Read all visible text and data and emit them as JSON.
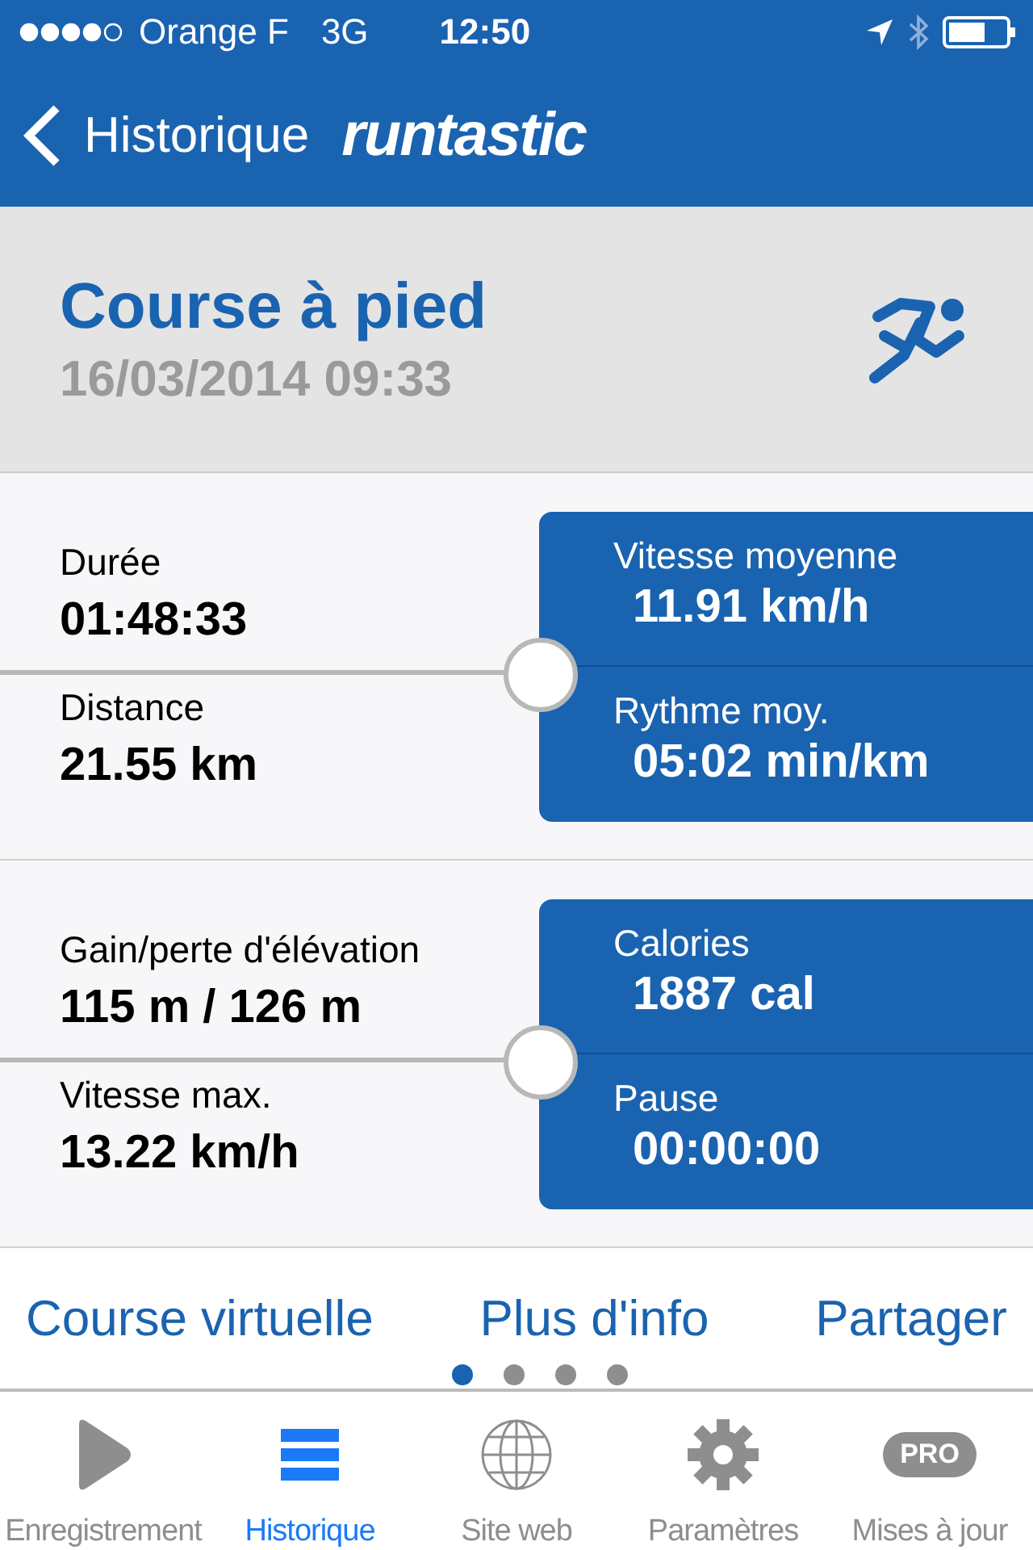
{
  "status_bar": {
    "carrier": "Orange F",
    "network": "3G",
    "time": "12:50"
  },
  "nav": {
    "back_label": "Historique",
    "logo": "runtastic"
  },
  "activity": {
    "title": "Course à pied",
    "date": "16/03/2014 09:33"
  },
  "stat_groups": [
    {
      "left": [
        {
          "label": "Durée",
          "value": "01:48:33"
        },
        {
          "label": "Distance",
          "value": "21.55 km"
        }
      ],
      "right": [
        {
          "label": "Vitesse moyenne",
          "value": "11.91 km/h"
        },
        {
          "label": "Rythme moy.",
          "value": "05:02 min/km"
        }
      ]
    },
    {
      "left": [
        {
          "label": "Gain/perte d'élévation",
          "value": "115 m / 126 m"
        },
        {
          "label": "Vitesse max.",
          "value": "13.22 km/h"
        }
      ],
      "right": [
        {
          "label": "Calories",
          "value": "1887 cal"
        },
        {
          "label": "Pause",
          "value": "00:00:00"
        }
      ]
    }
  ],
  "actions": [
    "Course virtuelle",
    "Plus d'info",
    "Partager"
  ],
  "page_dots": [
    {
      "selected": true
    },
    {
      "selected": false
    },
    {
      "selected": false
    },
    {
      "selected": false
    }
  ],
  "tabs": [
    {
      "kind": "record",
      "label": "Enregistrement",
      "selected": false
    },
    {
      "kind": "history",
      "label": "Historique",
      "selected": true
    },
    {
      "kind": "web",
      "label": "Site web",
      "selected": false
    },
    {
      "kind": "settings",
      "label": "Paramètres",
      "selected": false
    },
    {
      "kind": "pro",
      "label": "Mises à jour",
      "badge": "PRO",
      "selected": false
    }
  ]
}
